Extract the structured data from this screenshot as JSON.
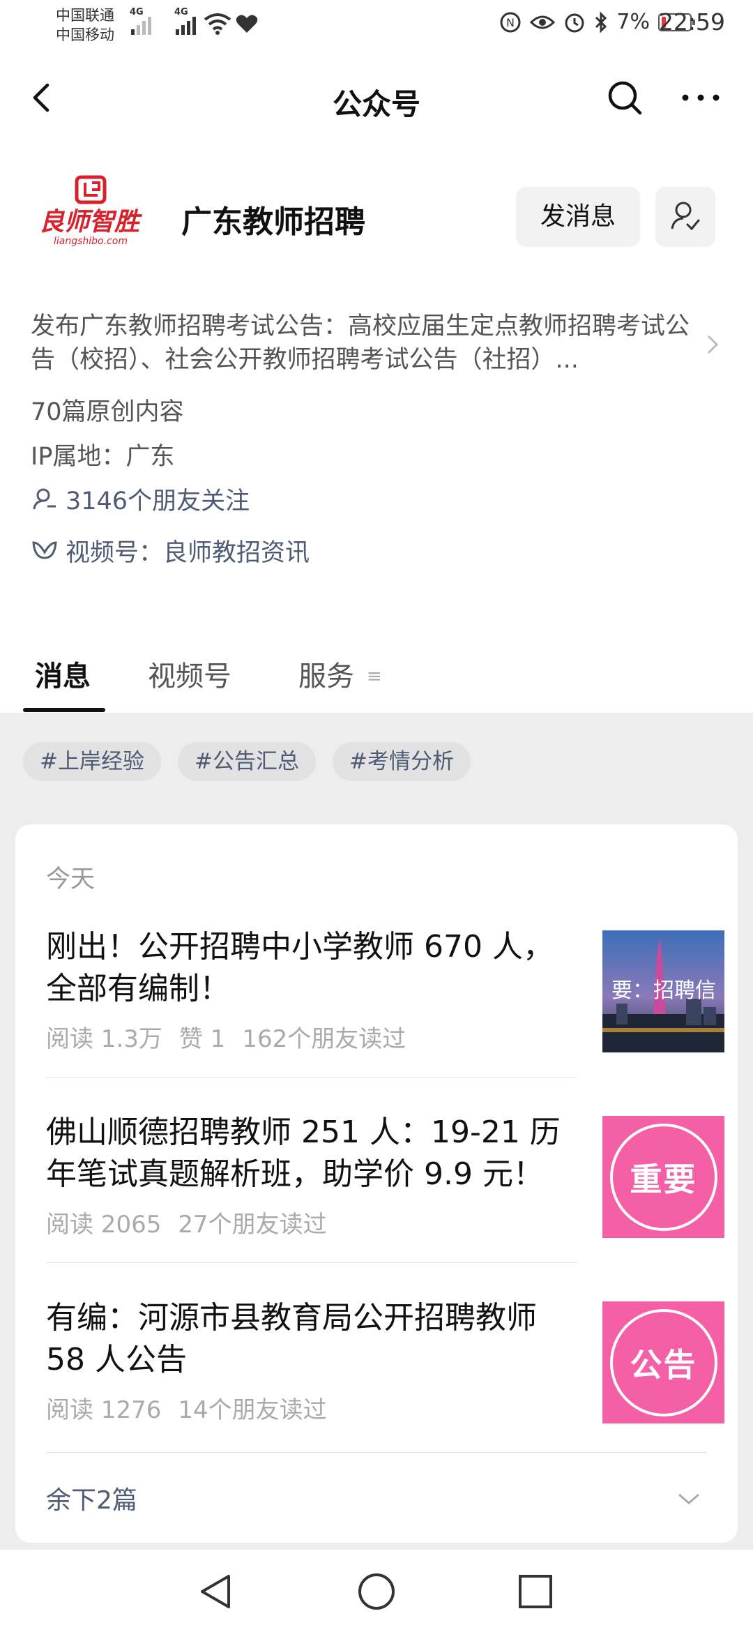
{
  "status_bar": {
    "carrier1": "中国联通",
    "carrier2": "中国移动",
    "net1": "4G",
    "net2": "4G",
    "battery": "7%",
    "time": "22:59"
  },
  "nav": {
    "title": "公众号"
  },
  "account": {
    "logo_text": "良师智胜",
    "logo_sub": "liangshibo.com",
    "name": "广东教师招聘",
    "message_button": "发消息",
    "description": "发布广东教师招聘考试公告：高校应届生定点教师招聘考试公告（校招）、社会公开教师招聘考试公告（社招）...",
    "original_count": "70篇原创内容",
    "ip_location": "IP属地：广东",
    "friends_following": "3146个朋友关注",
    "channel": "视频号：良师教招资讯"
  },
  "tabs": [
    {
      "label": "消息"
    },
    {
      "label": "视频号"
    },
    {
      "label": "服务"
    }
  ],
  "chips": [
    {
      "label": "#上岸经验"
    },
    {
      "label": "#公告汇总"
    },
    {
      "label": "#考情分析"
    }
  ],
  "feed": {
    "date_header": "今天",
    "articles": [
      {
        "title": "刚出！公开招聘中小学教师 670 人，全部有编制！",
        "reads": "阅读 1.3万",
        "likes": "赞 1",
        "friends": "162个朋友读过",
        "thumb_caption": "要：招聘信"
      },
      {
        "title": "佛山顺德招聘教师 251 人：19-21 历年笔试真题解析班，助学价 9.9 元！",
        "reads": "阅读 2065",
        "friends": "27个朋友读过",
        "thumb_caption": "重要"
      },
      {
        "title": "有编：河源市县教育局公开招聘教师 58 人公告",
        "reads": "阅读 1276",
        "friends": "14个朋友读过",
        "thumb_caption": "公告"
      }
    ],
    "more_label": "余下2篇"
  },
  "colors": {
    "link": "#4f5a74",
    "thumb_pink": "#f45fa6",
    "logo_red": "#d7222c"
  }
}
